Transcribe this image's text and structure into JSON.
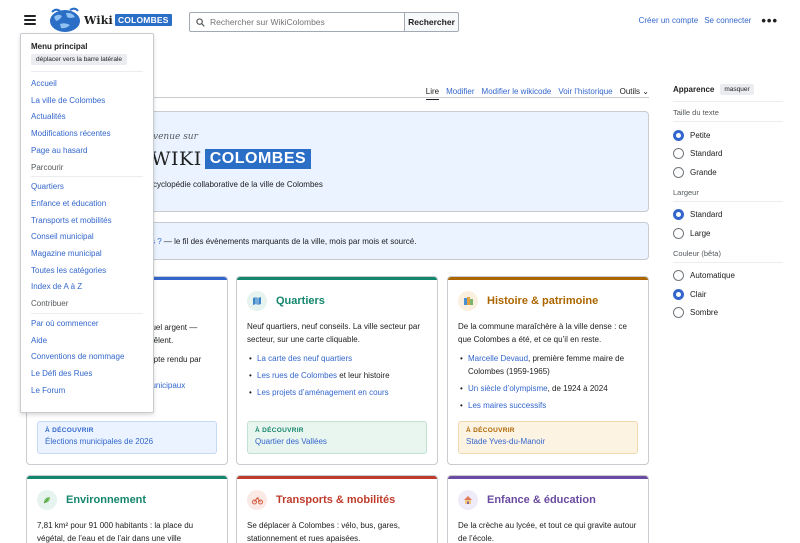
{
  "header": {
    "logo_text": "Wiki",
    "logo_tag": "COLOMBES",
    "search_placeholder": "Rechercher sur WikiColombes",
    "search_button": "Rechercher",
    "create_account": "Créer un compte",
    "login": "Se connecter",
    "more": "•••"
  },
  "tabs": {
    "read": "Lire",
    "edit": "Modifier",
    "edit_source": "Modifier le wikicode",
    "history": "Voir l’historique",
    "tools": "Outils"
  },
  "welcome": {
    "intro": "venue sur",
    "big_left": "WIKI",
    "big_tag": "COLOMBES",
    "desc": "cyclopédie collaborative de la ville de Colombes"
  },
  "news": {
    "link": "s ?",
    "text": " — le fil des évènements marquants de la ville, mois par mois et sourcé."
  },
  "menu": {
    "title": "Menu principal",
    "move": "déplacer vers la barre latérale",
    "items_a": [
      "Accueil",
      "La ville de Colombes",
      "Actualités",
      "Modifications récentes",
      "Page au hasard"
    ],
    "section_b": "Parcourir",
    "items_b": [
      "Quartiers",
      "Enfance et éducation",
      "Transports et mobilités",
      "Conseil municipal",
      "Magazine municipal",
      "Toutes les catégories",
      "Index de A à Z"
    ],
    "section_c": "Contribuer",
    "items_c": [
      "Par où commencer",
      "Aide",
      "Conventions de nommage",
      "Le Défi des Rues",
      "Le Forum"
    ]
  },
  "cards": {
    "c1": {
      "text1": "quel argent —",
      "text2": "mêlent.",
      "text3": "mpte rendu par",
      "text4": "nunicipaux",
      "disc_label": "À DÉCOUVRIR",
      "disc_value": "Élections municipales de 2026",
      "color": "#3366cc"
    },
    "c2": {
      "title": "Quartiers",
      "body": "Neuf quartiers, neuf conseils. La ville secteur par secteur, sur une carte cliquable.",
      "links": [
        "La carte des neuf quartiers",
        "Les rues de Colombes",
        "Les projets d’aménagement en cours"
      ],
      "link2_suffix": " et leur histoire",
      "disc_label": "À DÉCOUVRIR",
      "disc_value": "Quartier des Vallées",
      "color": "#14866d"
    },
    "c3": {
      "title": "Histoire & patrimoine",
      "body": "De la commune maraîchère à la ville dense : ce que Colombes a été, et ce qu’il en reste.",
      "item1_link": "Marcelle Devaud",
      "item1_rest": ", première femme maire de Colombes (1959-1965)",
      "item2_link": "Un siècle d’olympisme",
      "item2_rest": ", de 1924 à 2024",
      "item3_link": "Les maires successifs",
      "disc_label": "À DÉCOUVRIR",
      "disc_value": "Stade Yves-du-Manoir",
      "color": "#ac6600"
    },
    "c4": {
      "title": "Environnement",
      "body": "7,81 km² pour 91 000 habitants : la place du végétal, de l’eau et de l’air dans une ville",
      "color": "#14866d"
    },
    "c5": {
      "title": "Transports & mobilités",
      "body": "Se déplacer à Colombes : vélo, bus, gares, stationnement et rues apaisées.",
      "color": "#bf3c2c"
    },
    "c6": {
      "title": "Enfance & éducation",
      "body": "De la crèche au lycée, et tout ce qui gravite autour de l’école.",
      "color": "#6b4ba1"
    }
  },
  "appearance": {
    "title": "Apparence",
    "hide": "masquer",
    "text_size": "Taille du texte",
    "sizes": [
      "Petite",
      "Standard",
      "Grande"
    ],
    "width": "Largeur",
    "widths": [
      "Standard",
      "Large"
    ],
    "color": "Couleur (bêta)",
    "colors": [
      "Automatique",
      "Clair",
      "Sombre"
    ]
  }
}
